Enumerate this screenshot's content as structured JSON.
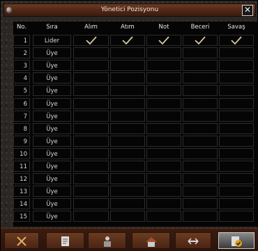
{
  "window": {
    "title": "Yönetici Pozisyonu",
    "close_label": "✕"
  },
  "table": {
    "headers": {
      "no": "No.",
      "sira": "Sıra",
      "alim": "Alım",
      "atim": "Atım",
      "not": "Not",
      "beceri": "Beceri",
      "savas": "Savaş"
    },
    "rows": [
      {
        "no": "1",
        "rank": "Lider",
        "alim": true,
        "atim": true,
        "not": true,
        "beceri": true,
        "savas": true
      },
      {
        "no": "2",
        "rank": "Üye"
      },
      {
        "no": "3",
        "rank": "Üye"
      },
      {
        "no": "4",
        "rank": "Üye"
      },
      {
        "no": "5",
        "rank": "Üye"
      },
      {
        "no": "6",
        "rank": "Üye"
      },
      {
        "no": "7",
        "rank": "Üye"
      },
      {
        "no": "8",
        "rank": "Üye"
      },
      {
        "no": "9",
        "rank": "Üye"
      },
      {
        "no": "10",
        "rank": "Üye"
      },
      {
        "no": "11",
        "rank": "Üye"
      },
      {
        "no": "12",
        "rank": "Üye"
      },
      {
        "no": "13",
        "rank": "Üye"
      },
      {
        "no": "14",
        "rank": "Üye"
      },
      {
        "no": "15",
        "rank": "Üye"
      }
    ]
  },
  "bottom_bar": {
    "buttons": [
      {
        "name": "cancel-button",
        "icon": "crossed-swords-icon"
      },
      {
        "name": "write-note-button",
        "icon": "scroll-pen-icon"
      },
      {
        "name": "members-button",
        "icon": "members-icon"
      },
      {
        "name": "guild-house-button",
        "icon": "house-icon"
      },
      {
        "name": "war-button",
        "icon": "sword-arrows-icon"
      },
      {
        "name": "grade-button",
        "icon": "checked-document-icon",
        "active": true
      }
    ]
  },
  "colors": {
    "title_bar": "#4c2515",
    "check": "#d8c9a0",
    "grid_bg": "#050505"
  }
}
